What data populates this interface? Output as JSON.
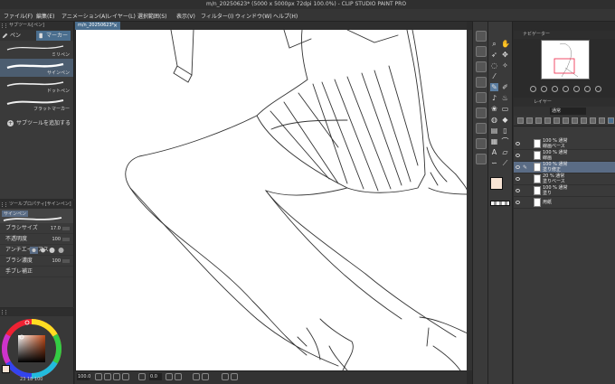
{
  "window": {
    "title": "m/n_20250623* (5000 x 5000px 72dpi 100.0%) - CLIP STUDIO PAINT PRO"
  },
  "menu": [
    "ファイル(F)",
    "編集(E)",
    "アニメーション(A)",
    "レイヤー(L)",
    "選択範囲(S)",
    "表示(V)",
    "フィルター(I)",
    "ウィンドウ(W)",
    "ヘルプ(H)"
  ],
  "subtool": {
    "header": "サブツール[ペン]",
    "tabs": [
      "ペン",
      "マーカー"
    ],
    "brushes": [
      {
        "label": "ミリペン",
        "selected": false
      },
      {
        "label": "サインペン",
        "selected": true
      },
      {
        "label": "ドットペン",
        "selected": false
      },
      {
        "label": "フラットマーカー",
        "selected": false
      }
    ],
    "add_label": "サブツールを追加する"
  },
  "tool_property": {
    "header": "ツールプロパティ[サインペン]",
    "name": "サインペン",
    "rows": [
      {
        "label": "ブラシサイズ",
        "value": "17.0"
      },
      {
        "label": "不透明度",
        "value": "100"
      },
      {
        "label": "アンチエイリアス",
        "value": ""
      },
      {
        "label": "ブラシ濃度",
        "value": "100"
      },
      {
        "label": "手ブレ補正",
        "value": ""
      }
    ]
  },
  "color": {
    "main": "#f8e4d4",
    "sub": "#ffffff",
    "hsv_readout": "23   18   100",
    "readout_numbers": [
      "23",
      "18",
      "100"
    ]
  },
  "document": {
    "tab": "m/n_20250623*"
  },
  "status": {
    "zoom": "100.0",
    "angle": "0.0"
  },
  "navigator": {
    "header": "ナビゲーター"
  },
  "layers": {
    "header": "レイヤー",
    "blend": "通常",
    "items": [
      {
        "l1": "100 % 通常",
        "l2": "線画ベース",
        "selected": false
      },
      {
        "l1": "100 % 通常",
        "l2": "線画",
        "selected": false
      },
      {
        "l1": "100 % 通常",
        "l2": "塗り修正",
        "selected": true
      },
      {
        "l1": "20 % 通常",
        "l2": "塗りベース",
        "selected": false
      },
      {
        "l1": "100 % 通常",
        "l2": "塗り",
        "selected": false
      },
      {
        "l1": "",
        "l2": "用紙",
        "selected": false
      }
    ]
  },
  "colors": {
    "accent": "#4a6e8e",
    "panel": "#3a3a3a",
    "selected_layer": "#5a6c85"
  }
}
